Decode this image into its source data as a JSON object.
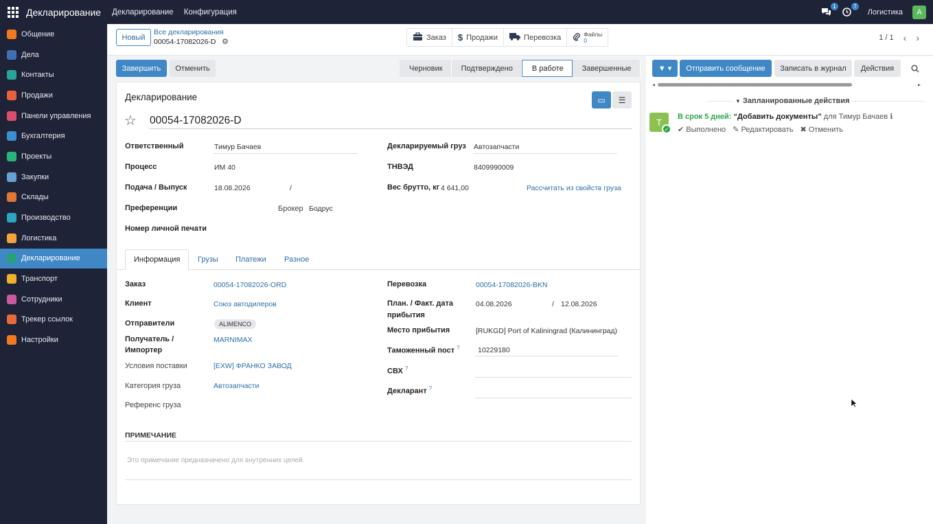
{
  "topbar": {
    "brand": "Декларирование",
    "menu": [
      "Декларирование",
      "Конфигурация"
    ],
    "chat_count": "1",
    "activity_count": "7",
    "company": "Логистика",
    "avatar": "A"
  },
  "sidebar": {
    "items": [
      {
        "label": "Общение",
        "color": "#f07b1e"
      },
      {
        "label": "Дела",
        "color": "#3f6fb5"
      },
      {
        "label": "Контакты",
        "color": "#2aa39a"
      },
      {
        "label": "Продажи",
        "color": "#e8603c"
      },
      {
        "label": "Панели управления",
        "color": "#d94f6b"
      },
      {
        "label": "Бухгалтерия",
        "color": "#3b8fd0"
      },
      {
        "label": "Проекты",
        "color": "#2ab67a"
      },
      {
        "label": "Закупки",
        "color": "#6a9fd4"
      },
      {
        "label": "Склады",
        "color": "#e27633"
      },
      {
        "label": "Производство",
        "color": "#2aa6c0"
      },
      {
        "label": "Логистика",
        "color": "#f0a63a"
      },
      {
        "label": "Декларирование",
        "color": "#27a07c"
      },
      {
        "label": "Транспорт",
        "color": "#f0b02a"
      },
      {
        "label": "Сотрудники",
        "color": "#c85a9e"
      },
      {
        "label": "Трекер ссылок",
        "color": "#e86a3a"
      },
      {
        "label": "Настройки",
        "color": "#f07b1e"
      }
    ],
    "active_index": 11
  },
  "control": {
    "new_label": "Новый",
    "breadcrumb_parent": "Все декларирования",
    "breadcrumb_current": "00054-17082026-D",
    "smart_buttons": [
      {
        "icon": "briefcase-icon",
        "label": "Заказ"
      },
      {
        "icon": "dollar-icon",
        "label": "Продажи"
      },
      {
        "icon": "truck-icon",
        "label": "Перевозка"
      }
    ],
    "files_label": "Файлы",
    "files_count": "0",
    "pager": "1 / 1"
  },
  "actions": {
    "finish": "Завершить",
    "cancel": "Отменить"
  },
  "stages": [
    "Черновик",
    "Подтверждено",
    "В работе",
    "Завершенные"
  ],
  "active_stage": 2,
  "form": {
    "title": "Декларирование",
    "name": "00054-17082026-D",
    "responsible_label": "Ответственный",
    "responsible": "Тимур Бачаев",
    "process_label": "Процесс",
    "process": "ИМ 40",
    "submit_label": "Подача / Выпуск",
    "submit_date": "18.08.2026",
    "submit_sep": "/",
    "preferences_label": "Преференции",
    "broker_label": "Брокер",
    "broker": "Бодрус",
    "seal_label": "Номер личной печати",
    "cargo_label": "Декларируемый груз",
    "cargo": "Автозапчасти",
    "hs_label": "ТНВЭД",
    "hs": "8409990009",
    "weight_label": "Вес брутто, кг",
    "weight": "4 641,00",
    "calc_link": "Рассчитать из свойств груза"
  },
  "tabs": [
    "Информация",
    "Грузы",
    "Платежи",
    "Разное"
  ],
  "info": {
    "order_label": "Заказ",
    "order": "00054-17082026-ORD",
    "client_label": "Клиент",
    "client": "Союз автодилеров",
    "senders_label": "Отправители",
    "sender_tag": "ALIMENCO",
    "receiver_label_1": "Получатель /",
    "receiver_label_2": "Импортер",
    "receiver": "MARNIMAX",
    "terms_label": "Условия поставки",
    "terms": "[EXW] ФРАНКО ЗАВОД",
    "cargo_cat_label": "Категория груза",
    "cargo_cat": "Автозапчасти",
    "cargo_ref_label": "Референс груза",
    "transport_label": "Перевозка",
    "transport": "00054-17082026-BKN",
    "arrival_label_1": "План. / Факт. дата",
    "arrival_label_2": "прибытия",
    "arrival_plan": "04.08.2026",
    "arrival_sep": "/",
    "arrival_fact": "12.08.2026",
    "place_label": "Место прибытия",
    "place": "[RUKGD] Port of Kaliningrad (Калининград)",
    "customs_label": "Таможенный пост",
    "customs": "10229180",
    "svh_label": "СВХ",
    "declarant_label": "Декларант",
    "help_mark": "?"
  },
  "note": {
    "header": "ПРИМЕЧАНИЕ",
    "placeholder": "Это примечание предназначено для внутренних целей."
  },
  "chatter": {
    "send_message": "Отправить сообщение",
    "log_note": "Записать в журнал",
    "activities": "Действия",
    "planned_header": "Запланированные действия",
    "activity": {
      "avatar": "T",
      "due": "В срок 5 дней:",
      "summary": "“Добавить документы”",
      "for": "для Тимур Бачаев",
      "done": "Выполнено",
      "edit": "Редактировать",
      "cancel": "Отменить"
    }
  }
}
